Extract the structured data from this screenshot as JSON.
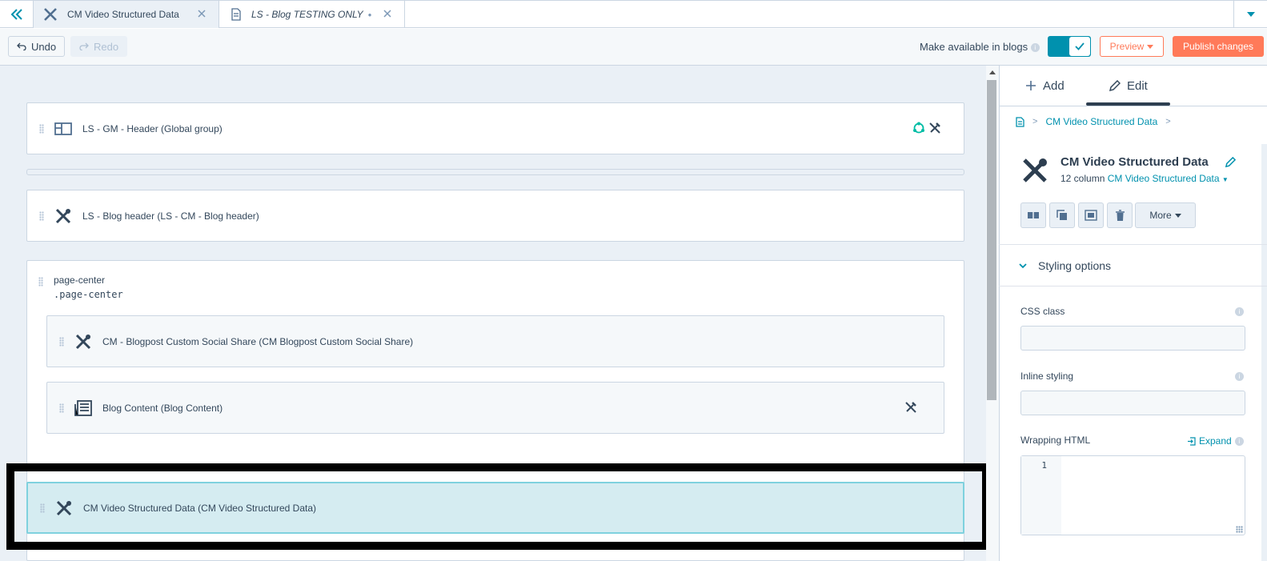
{
  "tabs": {
    "back_icon": "double-chevron-left-icon",
    "items": [
      {
        "label": "CM Video Structured Data",
        "icon": "wrench-screwdriver-icon",
        "active": true
      },
      {
        "label": "LS - Blog TESTING ONLY",
        "icon": "document-icon",
        "active": false,
        "italic": true
      }
    ]
  },
  "toolbar": {
    "undo_label": "Undo",
    "redo_label": "Redo",
    "make_available_label": "Make available in blogs",
    "preview_label": "Preview",
    "publish_label": "Publish changes"
  },
  "canvas": {
    "modules": [
      {
        "label": "LS - GM - Header (Global group)",
        "icon": "layout-icon"
      },
      {
        "label": "LS - Blog header (LS - CM - Blog header)",
        "icon": "wrench-screwdriver-icon"
      }
    ],
    "group": {
      "name": "page-center",
      "css_class": ".page-center",
      "children": [
        {
          "label": "CM - Blogpost Custom Social Share (CM Blogpost Custom Social Share)",
          "icon": "wrench-screwdriver-icon"
        },
        {
          "label": "Blog Content (Blog Content)",
          "icon": "blog-content-icon"
        }
      ]
    },
    "selected_module": {
      "label": "CM Video Structured Data (CM Video Structured Data)",
      "icon": "wrench-screwdriver-icon"
    }
  },
  "panel": {
    "tab_add": "Add",
    "tab_edit": "Edit",
    "breadcrumb": "CM Video Structured Data",
    "module_title": "CM Video Structured Data",
    "column_text": "12 column",
    "column_link": "CM Video Structured Data",
    "more_label": "More",
    "styling_title": "Styling options",
    "css_class_label": "CSS class",
    "inline_styling_label": "Inline styling",
    "wrapping_html_label": "Wrapping HTML",
    "expand_label": "Expand",
    "code_line": "1"
  },
  "colors": {
    "accent": "#0091ae",
    "primary_cta": "#ff7a59",
    "selected_bg": "#d5ecf1"
  }
}
